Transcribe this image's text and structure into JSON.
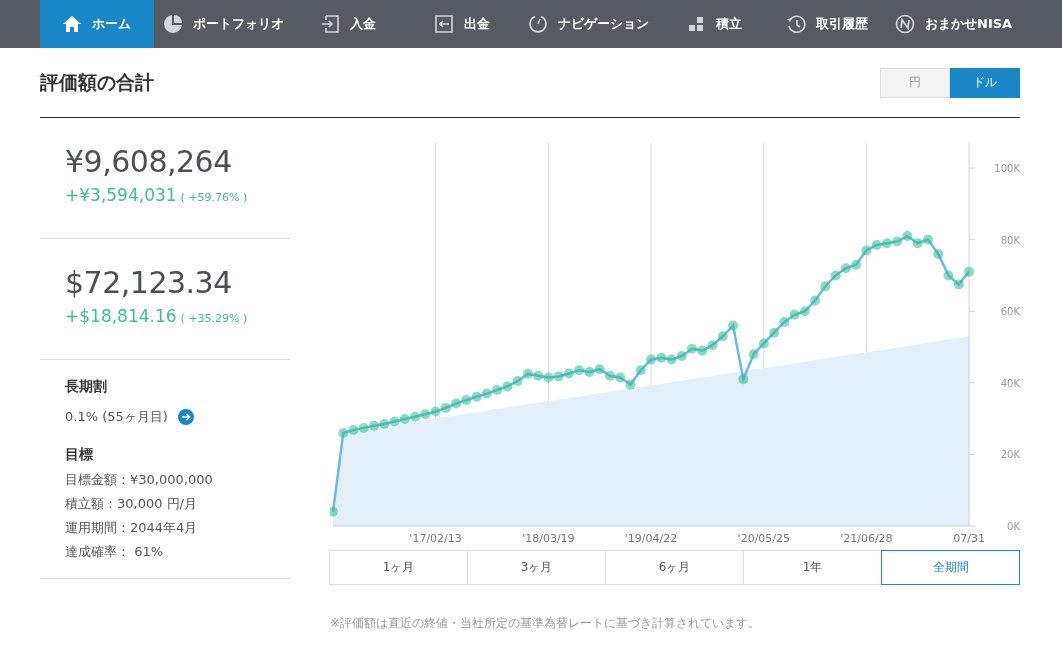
{
  "nav": [
    {
      "label": "ホーム",
      "kind": "home",
      "selected": true
    },
    {
      "label": "ポートフォリオ",
      "kind": "pie",
      "selected": false
    },
    {
      "label": "入金",
      "kind": "deposit",
      "selected": false
    },
    {
      "label": "出金",
      "kind": "withdraw",
      "selected": false
    },
    {
      "label": "ナビゲーション",
      "kind": "gauge",
      "selected": false
    },
    {
      "label": "積立",
      "kind": "blocks",
      "selected": false
    },
    {
      "label": "取引履歴",
      "kind": "history",
      "selected": false
    },
    {
      "label": "おまかせNISA",
      "kind": "logo",
      "selected": false
    }
  ],
  "title": "評価額の合計",
  "currency_toggle": [
    {
      "label": "円",
      "selected": false
    },
    {
      "label": "ドル",
      "selected": true
    }
  ],
  "totals": [
    {
      "amount": "¥9,608,264",
      "change": "+¥3,594,031",
      "change_pct": "( +59.76% )"
    },
    {
      "amount": "$72,123.34",
      "change": "+$18,814.16",
      "change_pct": "( +35.29% )"
    }
  ],
  "long_term": {
    "heading": "長期割",
    "value": "0.1% (55ヶ月目)"
  },
  "goal": {
    "heading": "目標",
    "lines": [
      "目標金額：¥30,000,000",
      "積立額：30,000 円/月",
      "運用期間：2044年4月",
      "達成確率： 61%"
    ]
  },
  "chart_data": {
    "type": "line",
    "categories": [
      null,
      null,
      null,
      null,
      null,
      null,
      null,
      null,
      null,
      null,
      "'17/02/13",
      null,
      null,
      null,
      null,
      null,
      null,
      null,
      null,
      null,
      null,
      "'18/03/19",
      null,
      null,
      null,
      null,
      null,
      null,
      null,
      null,
      null,
      "'19/04/22",
      null,
      null,
      null,
      null,
      null,
      null,
      null,
      null,
      null,
      null,
      "'20/05/25",
      null,
      null,
      null,
      null,
      null,
      null,
      null,
      null,
      null,
      "'21/06/28",
      null,
      null,
      null,
      null,
      null,
      null,
      null,
      null,
      null,
      "07/31"
    ],
    "series": [
      {
        "type": "area",
        "color": "#e3f0f9",
        "values": [
          4,
          26.1,
          26.5,
          27.0,
          27.4,
          27.9,
          28.3,
          28.7,
          29.2,
          29.6,
          30.1,
          30.5,
          30.9,
          31.4,
          31.8,
          32.3,
          32.7,
          33.1,
          33.6,
          34.0,
          34.5,
          34.9,
          35.3,
          35.8,
          36.2,
          36.7,
          37.1,
          37.5,
          38.0,
          38.4,
          38.9,
          39.3,
          39.7,
          40.2,
          40.6,
          41.1,
          41.5,
          41.9,
          42.4,
          42.8,
          43.3,
          43.7,
          44.1,
          44.6,
          45.0,
          45.5,
          45.9,
          46.3,
          46.8,
          47.2,
          47.7,
          48.1,
          48.5,
          49.0,
          49.4,
          49.9,
          50.3,
          50.7,
          51.2,
          51.6,
          52.1,
          52.5,
          52.9
        ]
      },
      {
        "type": "line",
        "color": "#6cb8e8",
        "marker": true,
        "values": [
          4,
          26,
          26.8,
          27.4,
          28,
          28.5,
          29.2,
          29.9,
          30.5,
          31.2,
          32,
          33,
          34.2,
          35.2,
          36.1,
          37,
          38,
          39,
          40.5,
          42.5,
          42,
          41.5,
          41.8,
          42.6,
          43.5,
          43,
          43.8,
          42,
          41.5,
          39.5,
          43.5,
          46.5,
          47,
          46.5,
          47.5,
          49.5,
          49,
          50.5,
          53,
          56,
          41,
          48,
          51,
          54,
          57,
          59,
          60,
          63,
          67,
          70,
          72,
          73,
          77,
          78.5,
          79,
          79.5,
          81,
          79,
          80,
          76,
          70,
          67.5,
          71
        ]
      }
    ],
    "ylim": [
      0,
      107
    ],
    "grid": true,
    "yticks": [
      {
        "value": 0,
        "label": "0K"
      },
      {
        "value": 20,
        "label": "20K"
      },
      {
        "value": 40,
        "label": "40K"
      },
      {
        "value": 60,
        "label": "60K"
      },
      {
        "value": 80,
        "label": "80K"
      },
      {
        "value": 100,
        "label": "100K"
      }
    ]
  },
  "periods": [
    {
      "label": "1ヶ月",
      "selected": false
    },
    {
      "label": "3ヶ月",
      "selected": false
    },
    {
      "label": "6ヶ月",
      "selected": false
    },
    {
      "label": "1年",
      "selected": false
    },
    {
      "label": "全期間",
      "selected": true
    }
  ],
  "footnote": "※評価額は直近の終値・当社所定の基準為替レートに基づき計算されています。"
}
